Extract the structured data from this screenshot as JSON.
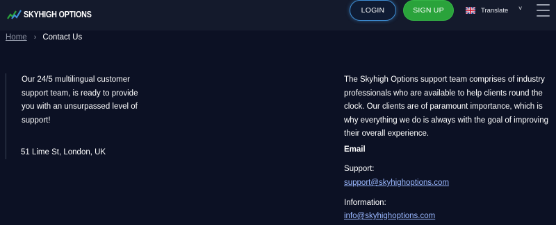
{
  "header": {
    "logo_text": "SKYHIGH OPTIONS",
    "login_label": "LOGIN",
    "signup_label": "SIGN UP",
    "translate_label": "Translate",
    "caret": "˅"
  },
  "breadcrumb": {
    "home": "Home",
    "separator": "›",
    "current": "Contact Us"
  },
  "left": {
    "intro": "Our 24/5 multilingual customer support team, is ready to provide you with an unsurpassed level of support!",
    "address": "51 Lime St, London, UK"
  },
  "right": {
    "intro": "The Skyhigh Options support team comprises of industry professionals who are available to help clients round the clock. Our clients are of paramount importance, which is why everything we do is always with the goal of improving their overall experience.",
    "email_heading": "Email",
    "support_label": "Support:",
    "support_email": "support@skyhighoptions.com",
    "info_label": "Information:",
    "info_email": "info@skyhighoptions.com"
  },
  "colors": {
    "background": "#0c1124",
    "header": "#141a2c",
    "signup_green": "#2aa33b",
    "login_border": "#3f8fd6",
    "link": "#9ab8ff"
  },
  "icons": {
    "logo": "skyhigh-chart-logo-icon",
    "flag": "uk-flag-icon",
    "menu": "hamburger-menu-icon"
  }
}
